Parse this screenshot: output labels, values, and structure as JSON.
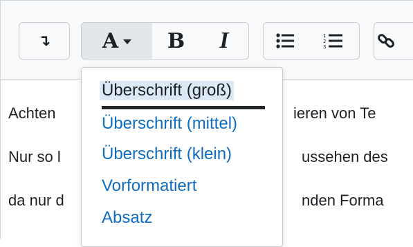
{
  "toolbar": {
    "collapse_icon": "↴",
    "format_letter": "A",
    "bold_letter": "B",
    "italic_letter": "I",
    "icons": {
      "collapse": "collapse-arrow-icon",
      "format": "paragraph-style-icon",
      "bold": "bold-icon",
      "italic": "italic-icon",
      "unordered_list": "unordered-list-icon",
      "ordered_list": "ordered-list-icon",
      "link": "link-icon"
    }
  },
  "format_menu": {
    "items": [
      {
        "label": "Überschrift (groß)",
        "active": true
      },
      {
        "label": "Überschrift (mittel)"
      },
      {
        "label": "Überschrift (klein)"
      },
      {
        "label": "Vorformatiert"
      },
      {
        "label": "Absatz"
      }
    ]
  },
  "content": {
    "lines": [
      {
        "left": "Achten",
        "right": "ieren von Te"
      },
      {
        "left": "Nur so l",
        "right": "ussehen des"
      },
      {
        "left": "da nur d",
        "right": "nden Forma"
      }
    ]
  },
  "colors": {
    "link": "#0f6cbf",
    "text": "#1d2125",
    "toolbar_bg": "#f8f9fa",
    "active_highlight": "#dbe8f6"
  }
}
